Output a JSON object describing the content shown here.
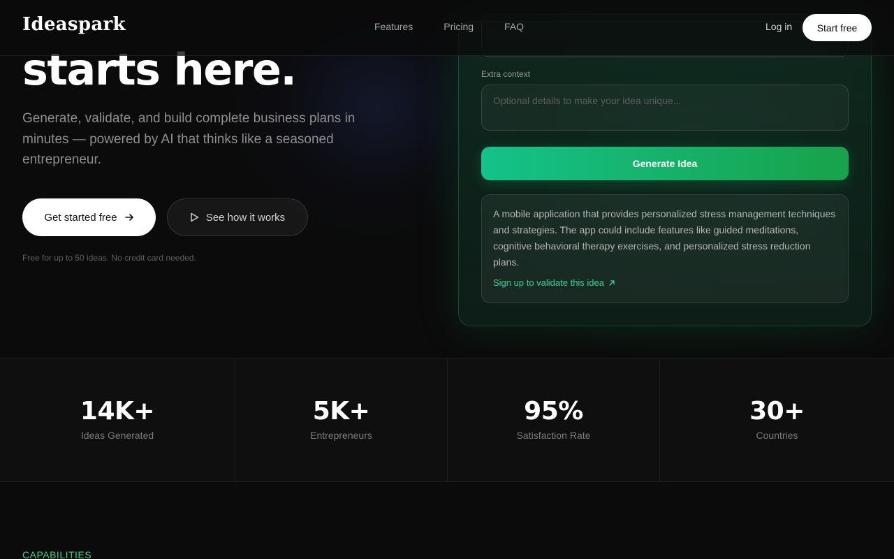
{
  "brand": {
    "logo": "Ideaspark",
    "accent": "#34d399",
    "button_gradient": [
      "#14c28a",
      "#18a24a"
    ]
  },
  "header": {
    "nav": [
      "Features",
      "Pricing",
      "FAQ"
    ],
    "login_label": "Log in",
    "start_label": "Start free"
  },
  "hero": {
    "title_line": "starts here.",
    "subtitle": "Generate, validate, and build complete business plans in minutes — powered by AI that thinks like a seasoned entrepreneur.",
    "primary_cta": "Get started free",
    "primary_icon": "arrow-right-icon",
    "secondary_cta": "See how it works",
    "secondary_icon": "play-icon",
    "fineprint": "Free for up to 50 ideas. No credit card needed."
  },
  "generator": {
    "context_label": "Extra context",
    "context_placeholder": "Optional details to make your idea unique...",
    "generate_label": "Generate Idea",
    "result_text": "A mobile application that provides personalized stress management techniques and strategies. The app could include features like guided meditations, cognitive behavioral therapy exercises, and personalized stress reduction plans.",
    "result_link": "Sign up to validate this idea",
    "result_link_icon": "arrow-up-right-icon"
  },
  "stats": [
    {
      "value": "14K+",
      "label": "Ideas Generated"
    },
    {
      "value": "5K+",
      "label": "Entrepreneurs"
    },
    {
      "value": "95%",
      "label": "Satisfaction Rate"
    },
    {
      "value": "30+",
      "label": "Countries"
    }
  ],
  "capabilities_label": "CAPABILITIES"
}
